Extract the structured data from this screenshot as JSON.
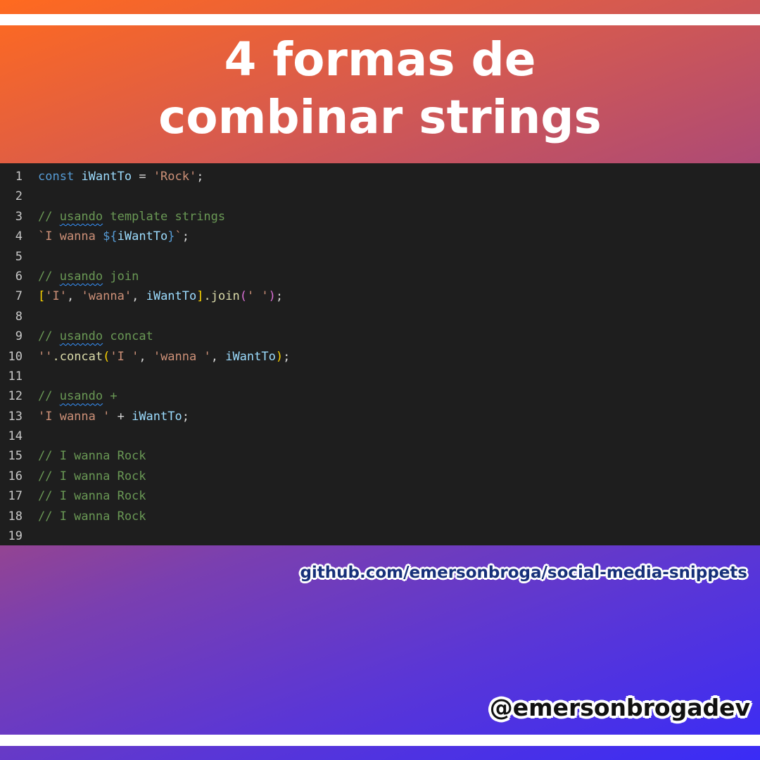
{
  "title": {
    "line1": "4 formas de",
    "line2": "combinar strings"
  },
  "editor": {
    "line_numbers": [
      "1",
      "2",
      "3",
      "4",
      "5",
      "6",
      "7",
      "8",
      "9",
      "10",
      "11",
      "12",
      "13",
      "14",
      "15",
      "16",
      "17",
      "18",
      "19"
    ],
    "tokens": {
      "const": "const",
      "iWantTo": "iWantTo",
      "eq": " = ",
      "rock": "'Rock'",
      "semi": ";",
      "slashes": "// ",
      "usando": "usando",
      "template_strings": " template strings",
      "backtick_open": "`I wanna ",
      "interp_open": "${",
      "interp_close": "}",
      "backtick_close": "`",
      "join_word": " join",
      "bracket_open": "[",
      "str_I": "'I'",
      "comma": ", ",
      "str_wanna": "'wanna'",
      "bracket_close": "]",
      "dot_join": ".join",
      "paren_open": "(",
      "str_space": "' '",
      "paren_close": ")",
      "concat_word": " concat",
      "empty_str": "''",
      "dot_concat": ".concat",
      "str_I_space": "'I '",
      "str_wanna_space": "'wanna '",
      "plus_word": " +",
      "str_I_wanna_space": "'I wanna '",
      "plus": " + ",
      "result_comment": "// I wanna Rock"
    }
  },
  "footer": {
    "repo_link": "github.com/emersonbroga/social-media-snippets",
    "handle": "@emersonbrogadev"
  },
  "colors": {
    "editor_bg": "#1e1e1e",
    "keyword": "#569cd6",
    "variable": "#9cdcfe",
    "string": "#ce9178",
    "comment": "#6a9955",
    "function": "#dcdcaa",
    "bracket_gold": "#ffd700",
    "bracket_purple": "#da70d6"
  }
}
